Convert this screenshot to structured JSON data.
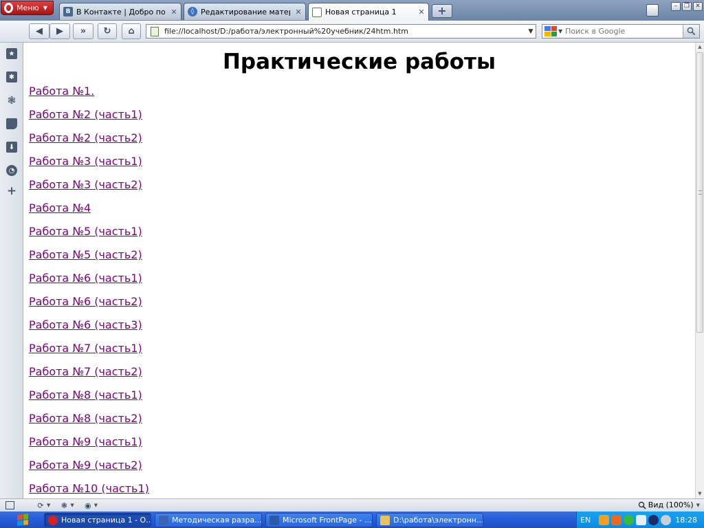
{
  "browser": {
    "menu_label": "Меню",
    "tabs": [
      {
        "title": "В Контакте | Добро по...",
        "icon": "vk-icon",
        "color": "#45688e",
        "glyph": "B"
      },
      {
        "title": "Редактирование матер...",
        "icon": "joomla-icon",
        "color": "#3a72c4",
        "glyph": "◊"
      },
      {
        "title": "Новая страница 1",
        "icon": "page-icon",
        "color": "#6b9b4b",
        "glyph": ""
      }
    ],
    "address_url": "file://localhost/D:/работа/электронный%20учебник/24htm.htm",
    "search_placeholder": "Поиск в Google",
    "status_zoom": "Вид (100%)"
  },
  "page": {
    "title": "Практические работы",
    "link_color": "#800080",
    "links": [
      "Работа №1.",
      "Работа №2 (часть1)",
      "Работа №2 (часть2)",
      "Работа №3 (часть1)",
      "Работа №3 (часть2)",
      "Работа №4",
      "Работа №5 (часть1)",
      "Работа №5 (часть2)",
      "Работа №6 (часть1)",
      "Работа №6 (часть2)",
      "Работа №6 (часть3)",
      "Работа №7 (часть1)",
      "Работа №7 (часть2)",
      "Работа №8 (часть1)",
      "Работа №8 (часть2)",
      "Работа №9 (часть1)",
      "Работа №9 (часть2)",
      "Работа №10 (часть1)"
    ]
  },
  "sidepanel": {
    "icons": [
      "bookmarks-icon",
      "widgets-icon",
      "unite-icon",
      "notes-icon",
      "downloads-icon",
      "history-icon",
      "add-panel-icon"
    ]
  },
  "taskbar": {
    "tasks": [
      {
        "title": "Новая страница 1 - О...",
        "icon": "opera-icon",
        "color": "#d42222"
      },
      {
        "title": "Методическая разра...",
        "icon": "word-icon",
        "color": "#3c64b4"
      },
      {
        "title": "Microsoft FrontPage - ...",
        "icon": "frontpage-icon",
        "color": "#2c5aa8"
      },
      {
        "title": "D:\\работа\\электронн...",
        "icon": "folder-icon",
        "color": "#e8c35a"
      }
    ],
    "language": "EN",
    "clock": "18:28"
  }
}
